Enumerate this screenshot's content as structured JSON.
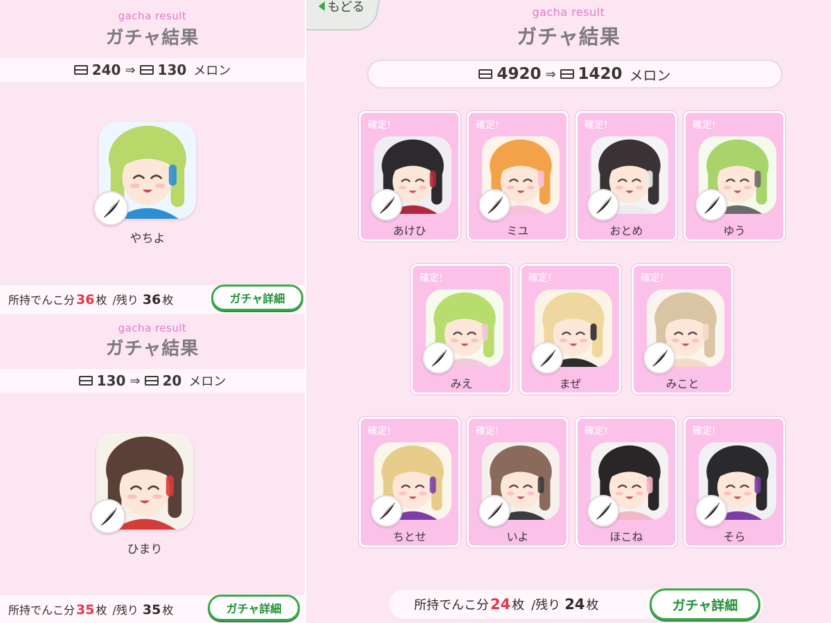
{
  "common": {
    "sub_title": "gacha result",
    "title": "ガチャ結果",
    "arrow": "⇒",
    "currency": "メロン",
    "guaranteed_label": "確定!",
    "detail_button": "ガチャ詳細",
    "stock_prefix": "所持でんこ分",
    "stock_unit": "枚",
    "remain_prefix": "/残り",
    "back_label": "もどる"
  },
  "panel_a": {
    "cost_before": "240",
    "cost_after": "130",
    "character": {
      "name": "やちよ",
      "hair": "#b8d86a",
      "bg": "#eef7ff",
      "accent": "#2c8fd1"
    },
    "stock_count": "36",
    "remain_count": "36"
  },
  "panel_b": {
    "cost_before": "130",
    "cost_after": "20",
    "character": {
      "name": "ひまり",
      "hair": "#5a4036",
      "bg": "#f7f1ec",
      "accent": "#d63b3b"
    },
    "stock_count": "35",
    "remain_count": "35"
  },
  "panel_main": {
    "cost_before": "4920",
    "cost_after": "1420",
    "stock_count": "24",
    "remain_count": "24",
    "cards": [
      {
        "name": "あけひ",
        "hair": "#2d2a2d",
        "bg": "#f0eef4",
        "accent": "#b0283a"
      },
      {
        "name": "ミユ",
        "hair": "#f4a24a",
        "bg": "#fff4ea",
        "accent": "#f6c2d9"
      },
      {
        "name": "おとめ",
        "hair": "#3a3335",
        "bg": "#f5f3f6",
        "accent": "#ececec"
      },
      {
        "name": "ゆう",
        "hair": "#a9d36b",
        "bg": "#f4fbec",
        "accent": "#6b6b6b"
      },
      {
        "name": "みえ",
        "hair": "#b7dd6d",
        "bg": "#f6fbee",
        "accent": "#f3c9dc"
      },
      {
        "name": "まぜ",
        "hair": "#efd8a0",
        "bg": "#fbf4e6",
        "accent": "#2d2d2d"
      },
      {
        "name": "みこと",
        "hair": "#d9c4a3",
        "bg": "#faf5ee",
        "accent": "#f6d9c9"
      },
      {
        "name": "ちとせ",
        "hair": "#e7cc8b",
        "bg": "#fbf6ea",
        "accent": "#7b3fa6"
      },
      {
        "name": "いよ",
        "hair": "#8a6a5a",
        "bg": "#f7f1ee",
        "accent": "#3c3c3c"
      },
      {
        "name": "ほこね",
        "hair": "#2a2628",
        "bg": "#f4f2f3",
        "accent": "#f3b7c8"
      },
      {
        "name": "そら",
        "hair": "#2a2a2c",
        "bg": "#f2f0f4",
        "accent": "#7b3fa6"
      }
    ]
  },
  "colors": {
    "panel_bg": "#fce6f2",
    "card_bg": "#fbc1e9",
    "sub_title": "#e07bc6",
    "highlight_red": "#e2374a",
    "button_green": "#3aa94a"
  }
}
